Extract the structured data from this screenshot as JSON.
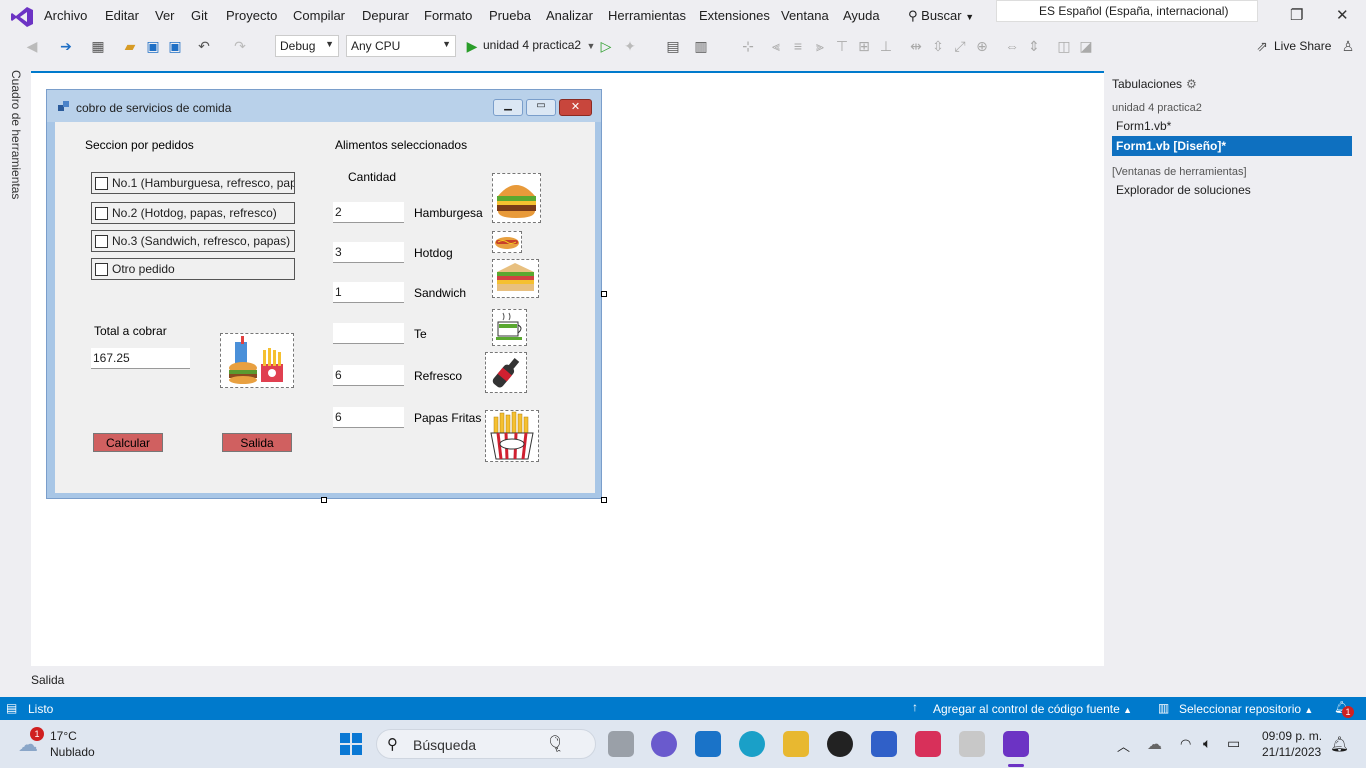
{
  "menubar": {
    "items": [
      "Archivo",
      "Editar",
      "Ver",
      "Git",
      "Proyecto",
      "Compilar",
      "Depurar",
      "Formato",
      "Prueba",
      "Analizar",
      "Herramientas",
      "Extensiones",
      "Ventana",
      "Ayuda"
    ],
    "search": "Buscar",
    "language": "ES Español (España, internacional)"
  },
  "toolbar": {
    "config": "Debug",
    "platform": "Any CPU",
    "run_target": "unidad 4 practica2",
    "live_share": "Live Share"
  },
  "left_sidebar": {
    "toolbox": "Cuadro de herramientas"
  },
  "form": {
    "title": "cobro de servicios de comida",
    "section_orders": "Seccion por pedidos",
    "checkboxes": [
      "No.1 (Hamburguesa, refresco, pap",
      "No.2 (Hotdog, papas, refresco)",
      "No.3 (Sandwich, refresco, papas)",
      "Otro pedido"
    ],
    "total_label": "Total a cobrar",
    "total_value": "167.25",
    "selected_header": "Alimentos seleccionados",
    "quantity_header": "Cantidad",
    "foods": [
      {
        "name": "Hamburgesa",
        "qty": "2"
      },
      {
        "name": "Hotdog",
        "qty": "3"
      },
      {
        "name": "Sandwich",
        "qty": "1"
      },
      {
        "name": "Te",
        "qty": ""
      },
      {
        "name": "Refresco",
        "qty": "6"
      },
      {
        "name": "Papas Fritas",
        "qty": "6"
      }
    ],
    "btn_calc": "Calcular",
    "btn_exit": "Salida"
  },
  "right_panel": {
    "title": "Tabulaciones",
    "group1": "unidad 4 practica2",
    "tab1": "Form1.vb*",
    "tab2": "Form1.vb [Diseño]*",
    "group2": "[Ventanas de herramientas]",
    "tab3": "Explorador de soluciones"
  },
  "output": {
    "label": "Salida"
  },
  "status": {
    "ready": "Listo",
    "source_control": "Agregar al control de código fuente",
    "repo": "Seleccionar repositorio",
    "notif_count": "1"
  },
  "taskbar": {
    "temp": "17°C",
    "weather": "Nublado",
    "weather_badge": "1",
    "search": "Búsqueda",
    "time": "09:09 p. m.",
    "date": "21/11/2023"
  },
  "colors": {
    "accent": "#007acc",
    "button": "#d06060",
    "selected_tab": "#0e70c0"
  }
}
